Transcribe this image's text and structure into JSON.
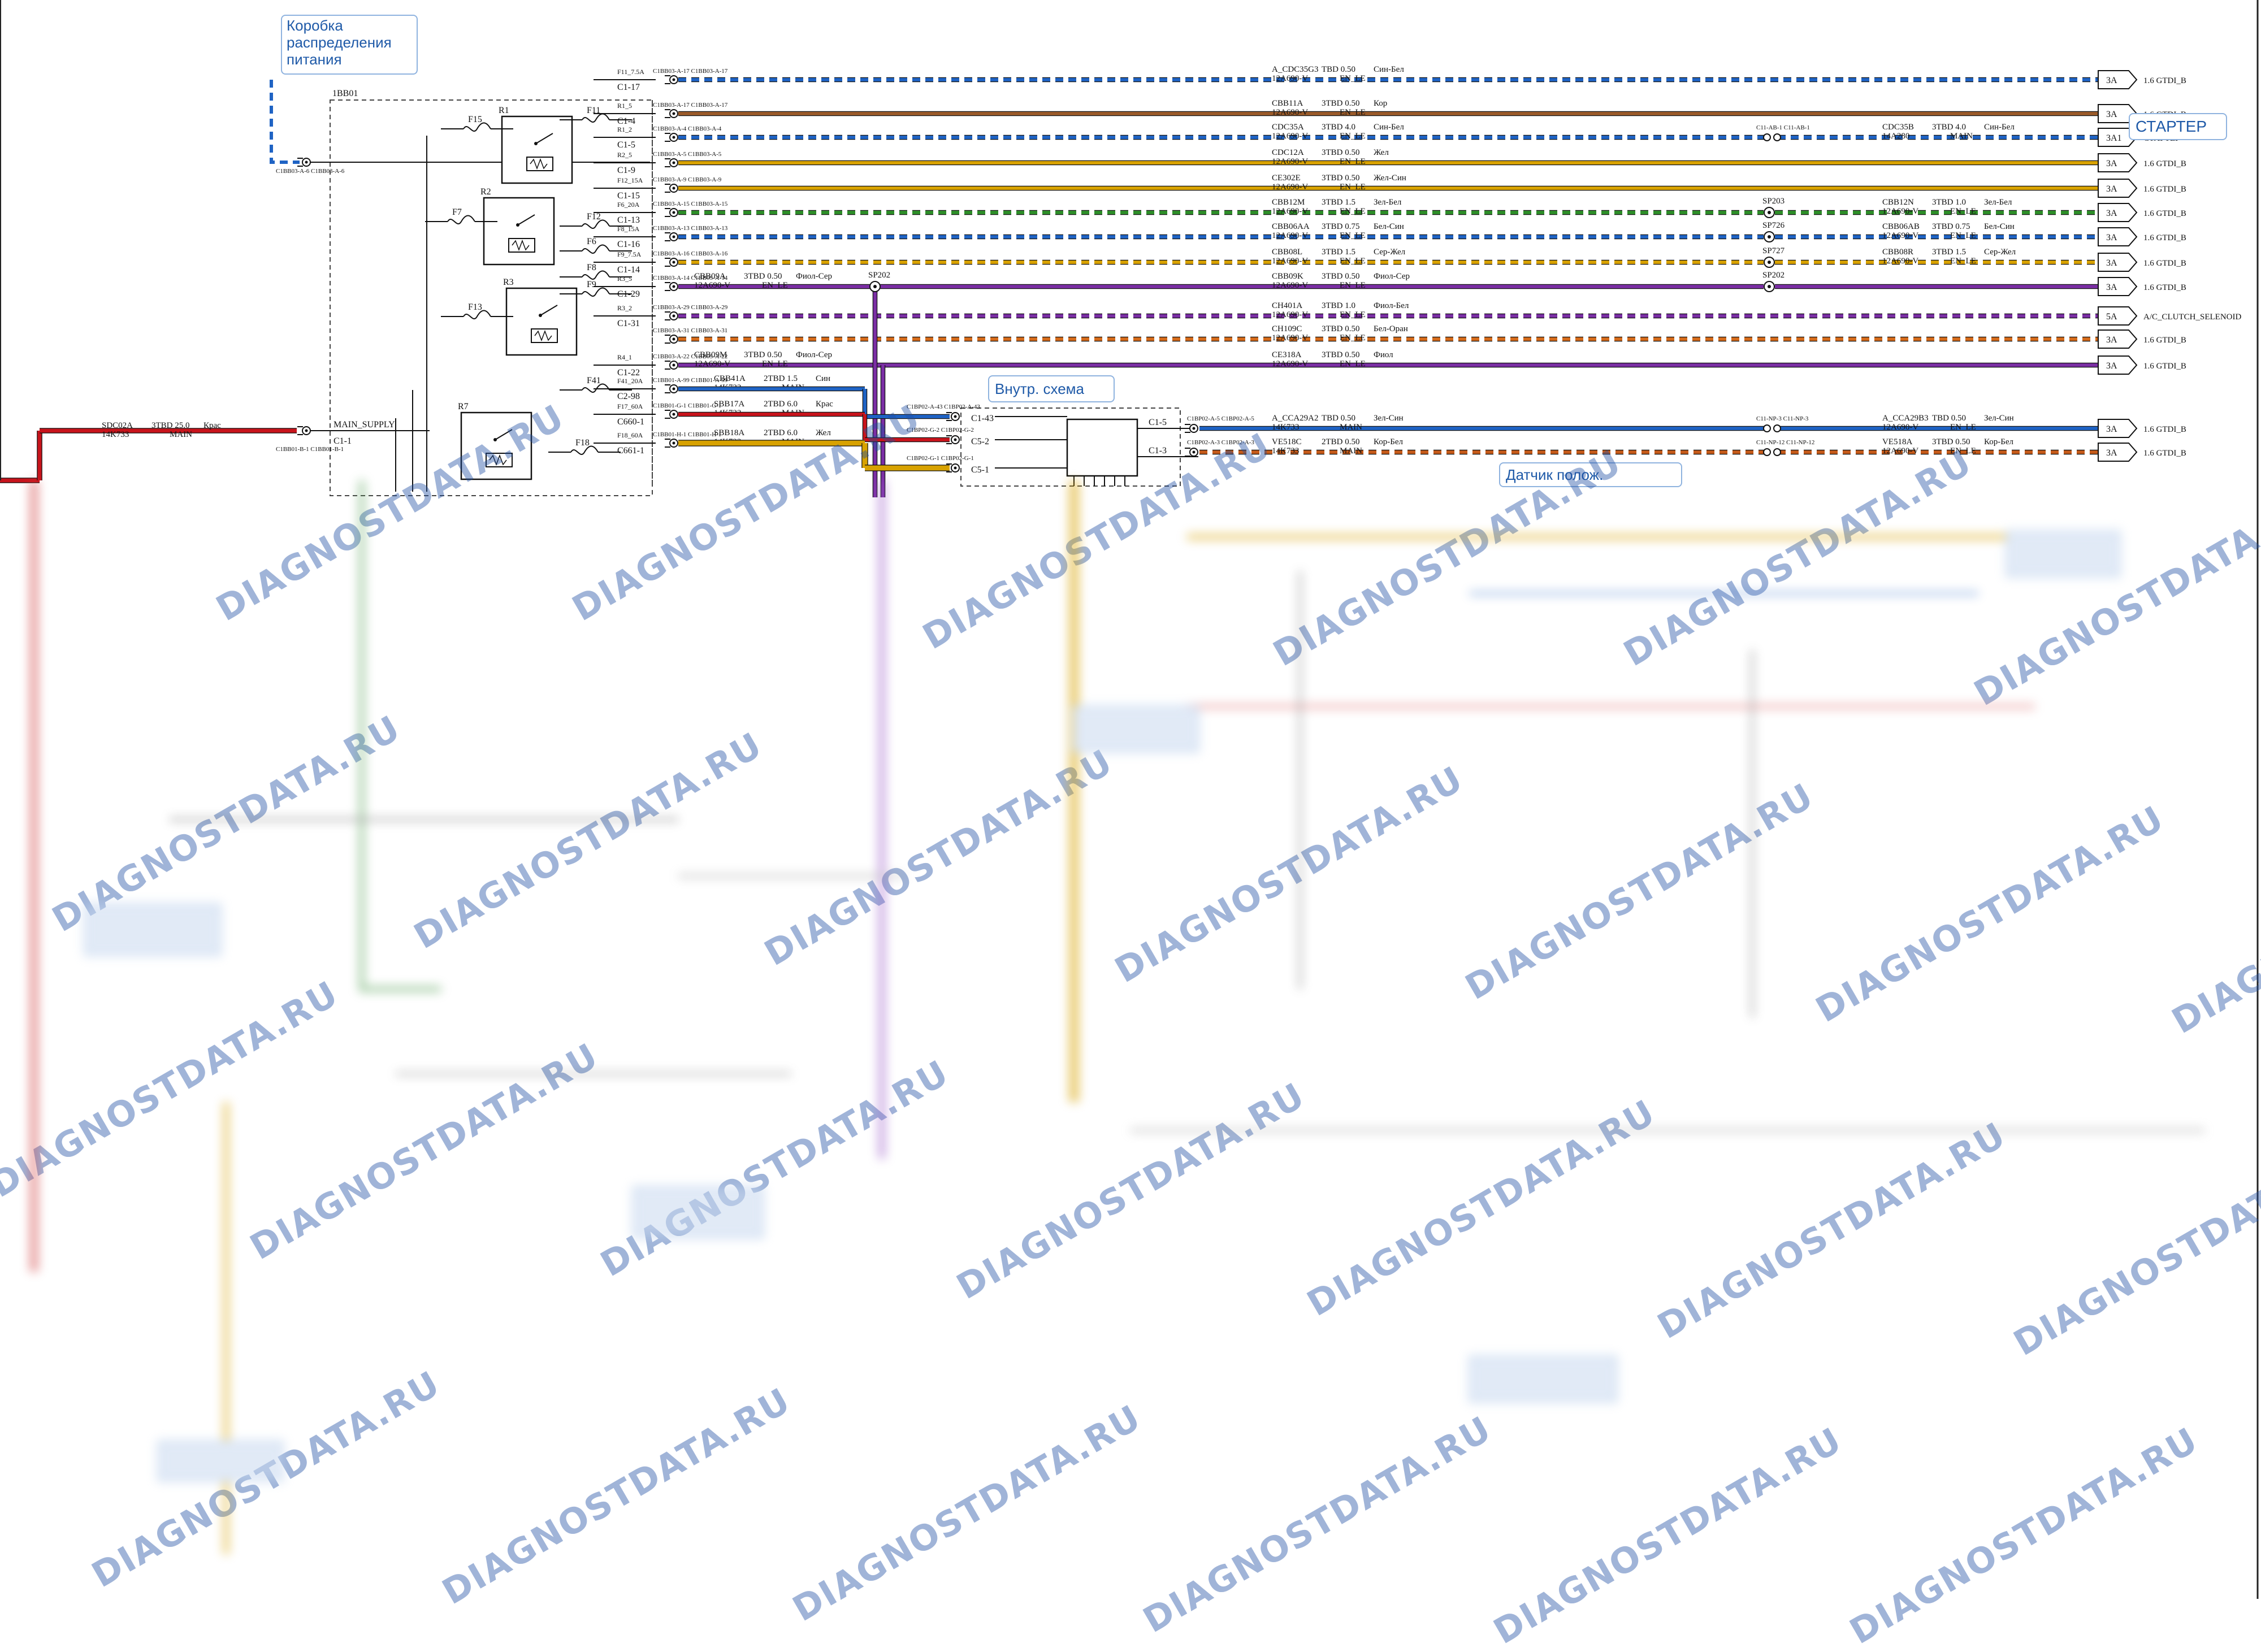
{
  "callouts": {
    "power_box": "Коробка\nраспределения\nпитания",
    "starter": "СТАРТЕР",
    "internal_scheme": "Внутр. схема",
    "position_sensor": "Датчик полож."
  },
  "block_label": "1BB01",
  "main_supply": {
    "wire": "SDC02A",
    "spec": "3TBD 25.0",
    "color": "Крас",
    "harness": "14K733",
    "bundle": "MAIN",
    "node": "MAIN_SUPPLY",
    "pin": "C1-1",
    "connector": "C1BB01-B-1 C1BB01-B-1"
  },
  "left_dashed_connector": "C1BB03-A-6 C1BB03-A-6",
  "fuses": [
    {
      "name": "F15"
    },
    {
      "name": "F11"
    },
    {
      "name": "F7"
    },
    {
      "name": "F12"
    },
    {
      "name": "F6"
    },
    {
      "name": "F8"
    },
    {
      "name": "F9"
    },
    {
      "name": "F13"
    },
    {
      "name": "F41"
    },
    {
      "name": "F18"
    }
  ],
  "relays": [
    {
      "name": "R1"
    },
    {
      "name": "R2"
    },
    {
      "name": "R3"
    },
    {
      "name": "R7"
    }
  ],
  "pins": [
    {
      "top": "F11_7.5A",
      "bottom": "C1-17"
    },
    {
      "top": "R1_5",
      "bottom": "C1-4"
    },
    {
      "top": "R1_2",
      "bottom": "C1-5"
    },
    {
      "top": "R2_5",
      "bottom": "C1-9"
    },
    {
      "top": "F12_15A",
      "bottom": "C1-15"
    },
    {
      "top": "F6_20A",
      "bottom": "C1-13"
    },
    {
      "top": "F8_15A",
      "bottom": "C1-16"
    },
    {
      "top": "F9_7.5A",
      "bottom": "C1-14"
    },
    {
      "top": "R3_5",
      "bottom": "C1-29"
    },
    {
      "top": "R3_2",
      "bottom": "C1-31"
    },
    {
      "top": "R4_1",
      "bottom": "C1-22"
    },
    {
      "top": "F41_20A",
      "bottom": "C2-98"
    },
    {
      "top": "F17_60A",
      "bottom": "C660-1"
    },
    {
      "top": "F18_60A",
      "bottom": "C661-1"
    }
  ],
  "circuits": [
    {
      "conn": "C1BB03-A-17 C1BB03-A-17",
      "wire": "A_CDC35G3",
      "spec": "TBD 0.50",
      "color": "Син-Бел",
      "harness": "12A690-V",
      "bundle": "EN_LE",
      "term": "3A",
      "dest": "1.6 GTDI_B",
      "hex": "#1f63c4"
    },
    {
      "conn": "C1BB03-A-17 C1BB03-A-17",
      "wire": "CBB11A",
      "spec": "3TBD 0.50",
      "color": "Кор",
      "harness": "12A690-V",
      "bundle": "EN_LE",
      "term": "3A",
      "dest": "1.6 GTDI_B",
      "hex": "#9a5b2a"
    },
    {
      "conn": "C1BB03-A-4 C1BB03-A-4",
      "wire": "CDC35A",
      "spec": "3TBD 4.0",
      "color": "Син-Бел",
      "harness": "12A690-V",
      "bundle": "EN_LE",
      "inline": "C11-AB-1 C11-AB-1",
      "wire2": "CDC35B",
      "spec2": "3TBD 4.0",
      "color2": "Син-Бел",
      "harness2": "14A280",
      "bundle2": "MAIN",
      "term": "3A1",
      "dest": "СТАРТЕР",
      "hex": "#1f63c4"
    },
    {
      "conn": "C1BB03-A-5 C1BB03-A-5",
      "wire": "CDC12A",
      "spec": "3TBD 0.50",
      "color": "Жел",
      "harness": "12A690-V",
      "bundle": "EN_LE",
      "term": "3A",
      "dest": "1.6 GTDI_B",
      "hex": "#d8a200"
    },
    {
      "conn": "C1BB03-A-9 C1BB03-A-9",
      "wire": "CE302E",
      "spec": "3TBD 0.50",
      "color": "Жел-Син",
      "harness": "12A690-V",
      "bundle": "EN_LE",
      "term": "3A",
      "dest": "1.6 GTDI_B",
      "hex": "#d8a200"
    },
    {
      "conn": "C1BB03-A-15 C1BB03-A-15",
      "wire": "CBB12M",
      "spec": "3TBD 1.5",
      "color": "Зел-Бел",
      "harness": "12A690-V",
      "bundle": "EN_LE",
      "splice": "SP203",
      "wire2": "CBB12N",
      "spec2": "3TBD 1.0",
      "color2": "Зел-Бел",
      "harness2": "12A690-V",
      "bundle2": "EN_LE",
      "term": "3A",
      "dest": "1.6 GTDI_B",
      "hex": "#2f8f2a"
    },
    {
      "conn": "C1BB03-A-13 C1BB03-A-13",
      "wire": "CBB06AA",
      "spec": "3TBD 0.75",
      "color": "Бел-Син",
      "harness": "12A690-V",
      "bundle": "EN_LE",
      "splice": "SP726",
      "wire2": "CBB06AB",
      "spec2": "3TBD 0.75",
      "color2": "Бел-Син",
      "harness2": "12A690-V",
      "bundle2": "EN_LE",
      "term": "3A",
      "dest": "1.6 GTDI_B",
      "hex": "#1f63c4"
    },
    {
      "conn": "C1BB03-A-16 C1BB03-A-16",
      "wire": "CBB08L",
      "spec": "3TBD 1.5",
      "color": "Сер-Жел",
      "harness": "12A690-V",
      "bundle": "EN_LE",
      "splice": "SP727",
      "wire2": "CBB08R",
      "spec2": "3TBD 1.5",
      "color2": "Сер-Жел",
      "harness2": "12A690-V",
      "bundle2": "EN_LE",
      "term": "3A",
      "dest": "1.6 GTDI_B",
      "hex": "#d8a200"
    },
    {
      "conn": "C1BB03-A-14 C1BB03-A-14",
      "wire": "CBB09K",
      "spec": "3TBD 0.50",
      "color": "Фиол-Сер",
      "harness": "12A690-V",
      "bundle": "EN_LE",
      "local_wire": "CBB09A",
      "local_spec": "3TBD 0.50",
      "local_color": "Фиол-Сер",
      "local_harness": "12A690-V",
      "local_bundle": "EN_LE",
      "splice": "SP202",
      "term": "3A",
      "dest": "1.6 GTDI_B",
      "hex": "#7a2ea3"
    },
    {
      "conn": "C1BB03-A-29 C1BB03-A-29",
      "wire": "CH401A",
      "spec": "3TBD 1.0",
      "color": "Фиол-Бел",
      "harness": "12A690-V",
      "bundle": "EN_LE",
      "term": "5A",
      "dest": "A/C_CLUTCH_SELENOID",
      "hex": "#7a2ea3"
    },
    {
      "conn": "C1BB03-A-31 C1BB03-A-31",
      "wire": "CH109C",
      "spec": "3TBD 0.50",
      "color": "Бел-Оран",
      "harness": "12A690-V",
      "bundle": "EN_LE",
      "term": "3A",
      "dest": "1.6 GTDI_B",
      "hex": "#d46a1a"
    },
    {
      "conn": "C1BB03-A-22 C1BB03-A-22",
      "wire": "CE318A",
      "spec": "3TBD 0.50",
      "color": "Фиол",
      "harness": "12A690-V",
      "bundle": "EN_LE",
      "local_wire": "CBB09M",
      "local_spec": "3TBD 0.50",
      "local_color": "Фиол-Сер",
      "local_harness": "12A690-V",
      "local_bundle": "EN_LE",
      "term": "3A",
      "dest": "1.6 GTDI_B",
      "hex": "#7a2ea3"
    }
  ],
  "lower_wires": [
    {
      "conn": "C1BB01-A-99 C1BB01-A-99",
      "wire": "CBB41A",
      "spec": "2TBD 1.5",
      "color": "Син",
      "harness": "14K733",
      "bundle": "MAIN"
    },
    {
      "conn": "C1BB01-G-1 C1BB01-G-1",
      "wire": "SBB17A",
      "spec": "2TBD 6.0",
      "color": "Крас",
      "harness": "14K733",
      "bundle": "MAIN"
    },
    {
      "conn": "C1BB01-H-1 C1BB01-H-1",
      "wire": "SBB18A",
      "spec": "2TBD 6.0",
      "color": "Жел",
      "harness": "14K733",
      "bundle": "MAIN"
    }
  ],
  "module": {
    "pins_left": [
      "C1-43",
      "C5-2",
      "C5-1"
    ],
    "conns_left": [
      "C1BP02-A-43 C1BP02-A-43",
      "C1BP02-G-2 C1BP02-G-2",
      "C1BP02-G-1 C1BP02-G-1"
    ],
    "pins_right": [
      "C1-5",
      "C1-3"
    ]
  },
  "sensor_circuits": [
    {
      "conn": "C1BP02-A-5 C1BP02-A-5",
      "wire": "A_CCA29A2",
      "spec": "TBD 0.50",
      "color": "Зел-Син",
      "harness": "14K733",
      "bundle": "MAIN",
      "inline": "C11-NP-3 C11-NP-3",
      "wire2": "A_CCA29B3",
      "spec2": "TBD 0.50",
      "color2": "Зел-Син",
      "harness2": "12A690-V",
      "bundle2": "EN_LE",
      "term": "3A",
      "dest": "1.6 GTDI_B",
      "hex": "#1f63c4"
    },
    {
      "conn": "C1BP02-A-3 C1BP02-A-3",
      "wire": "VE518C",
      "spec": "2TBD 0.50",
      "color": "Кор-Бел",
      "harness": "14K733",
      "bundle": "MAIN",
      "inline": "C11-NP-12 C11-NP-12",
      "wire2": "VE518A",
      "spec2": "3TBD 0.50",
      "color2": "Кор-Бел",
      "harness2": "12A690-V",
      "bundle2": "EN_LE",
      "term": "3A",
      "dest": "1.6 GTDI_B",
      "hex": "#c45a1a"
    }
  ],
  "watermark": "DIAGNOSTDATA.RU"
}
